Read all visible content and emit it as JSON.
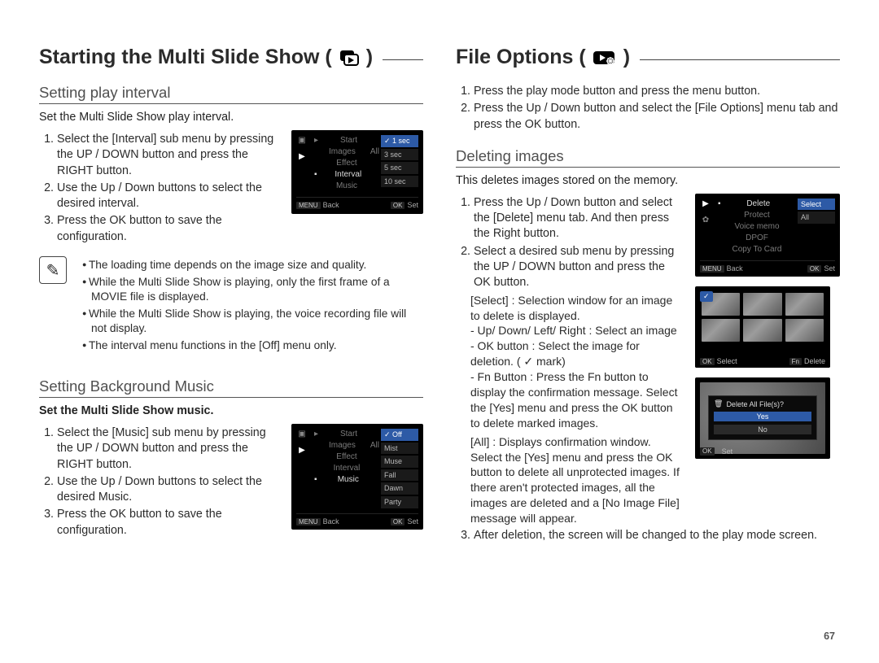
{
  "page_number": "67",
  "left": {
    "h1": "Starting the Multi Slide Show (",
    "h1_close": ")",
    "interval": {
      "h2": "Setting play interval",
      "intro": "Set the Multi Slide Show play interval.",
      "steps": [
        "Select the [Interval] sub menu by pressing the UP / DOWN button and press the RIGHT button.",
        "Use the Up / Down buttons to select the desired interval.",
        "Press the OK button to save the configuration."
      ]
    },
    "notes": [
      "The loading time depends on the image size and quality.",
      "While the Multi Slide Show is playing, only the first frame of a MOVIE file is displayed.",
      "While the Multi Slide Show is playing, the voice recording file will not display.",
      "The interval menu functions in the [Off] menu only."
    ],
    "bgm": {
      "h2": "Setting Background Music",
      "lead": "Set the Multi Slide Show music.",
      "steps": [
        "Select the [Music] sub menu by pressing the UP / DOWN button and press the RIGHT button.",
        "Use the Up / Down buttons to select the desired Music.",
        "Press the OK button to save the configuration."
      ]
    },
    "lcd_interval": {
      "menu_items": [
        "Start",
        "Images",
        "Effect",
        "Interval",
        "Music"
      ],
      "sel_index": 3,
      "right_dim": "All",
      "options": [
        "1 sec",
        "3 sec",
        "5 sec",
        "10 sec"
      ],
      "sel_option": 0,
      "footer_left": "Back",
      "footer_right": "Set",
      "footer_left_key": "MENU",
      "footer_right_key": "OK"
    },
    "lcd_music": {
      "menu_items": [
        "Start",
        "Images",
        "Effect",
        "Interval",
        "Music"
      ],
      "sel_index": 4,
      "right_dim": "All",
      "options": [
        "Off",
        "Mist",
        "Muse",
        "Fall",
        "Dawn",
        "Party"
      ],
      "sel_option": 0,
      "footer_left": "Back",
      "footer_right": "Set",
      "footer_left_key": "MENU",
      "footer_right_key": "OK"
    }
  },
  "right": {
    "h1": "File Options (",
    "h1_close": ")",
    "intro_steps": [
      "Press the play mode button and press the menu button.",
      "Press the Up / Down button and select the [File Options] menu tab and press the OK button."
    ],
    "delete": {
      "h2": "Deleting images",
      "intro": "This deletes images stored on the memory.",
      "step1": "Press the Up / Down button and select the [Delete] menu tab. And then press the Right button.",
      "step2": "Select a desired sub menu by pressing the UP / DOWN button and press the OK button.",
      "select_label": "[Select] : Selection window for an image to delete is displayed.",
      "select_sub": [
        "- Up/ Down/ Left/ Right : Select an image",
        "- OK button : Select the image for deletion. ( ✓ mark)",
        "- Fn Button : Press the Fn button to display the confirmation message. Select the [Yes] menu and press the OK button to delete marked images."
      ],
      "all_label": "[All] : Displays confirmation window. Select the [Yes] menu and press the OK button to delete all unprotected images. If there aren't protected images, all the images are deleted and a [No Image File] message will appear.",
      "step3": "After deletion, the screen will be changed to the play mode screen."
    },
    "lcd_delete": {
      "menu_items": [
        "Delete",
        "Protect",
        "Voice memo",
        "DPOF",
        "Copy To Card"
      ],
      "sel_index": 0,
      "options": [
        "Select",
        "All"
      ],
      "sel_option": 0,
      "footer_left": "Back",
      "footer_right": "Set",
      "footer_left_key": "MENU",
      "footer_right_key": "OK"
    },
    "grid_footer_left": "Select",
    "grid_footer_left_key": "OK",
    "grid_footer_right": "Delete",
    "grid_footer_right_key": "Fn",
    "confirm": {
      "title": "Delete All File(s)?",
      "yes": "Yes",
      "no": "No",
      "footer_key": "OK",
      "footer": "Set"
    }
  }
}
